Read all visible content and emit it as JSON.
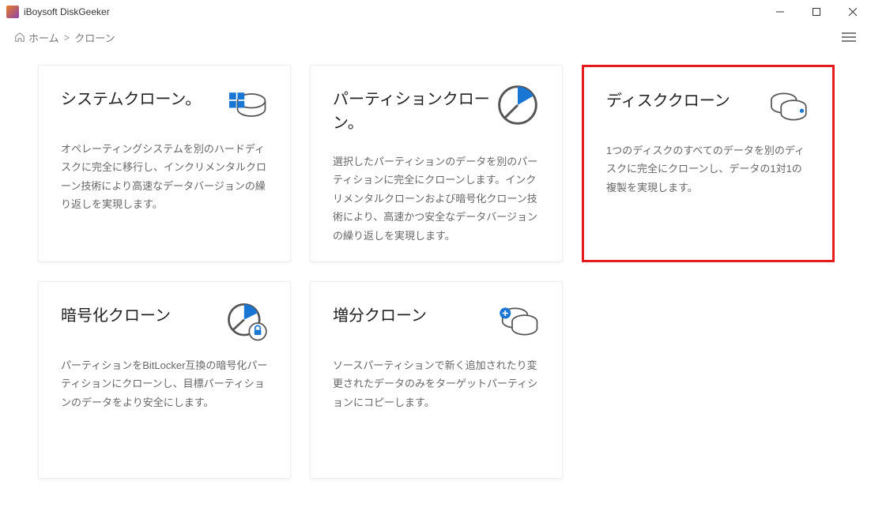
{
  "window": {
    "title": "iBoysoft DiskGeeker"
  },
  "breadcrumb": {
    "home": "ホーム",
    "sep": ">",
    "current": "クローン"
  },
  "cards": [
    {
      "title": "システムクローン。",
      "desc": "オペレーティングシステムを別のハードディスクに完全に移行し、インクリメンタルクローン技術により高速なデータバージョンの繰り返しを実現します。",
      "icon": "system-disk"
    },
    {
      "title": "パーティションクローン。",
      "desc": "選択したパーティションのデータを別のパーティションに完全にクローンします。インクリメンタルクローンおよび暗号化クローン技術により、高速かつ安全なデータバージョンの繰り返しを実現します。",
      "icon": "pie"
    },
    {
      "title": "ディスククローン",
      "desc": "1つのディスクのすべてのデータを別のディスクに完全にクローンし、データの1対1の複製を実現します。",
      "icon": "disks",
      "highlight": true
    },
    {
      "title": "暗号化クローン",
      "desc": "パーティションをBitLocker互換の暗号化パーティションにクローンし、目標パーティションのデータをより安全にします。",
      "icon": "pie-lock"
    },
    {
      "title": "増分クローン",
      "desc": "ソースパーティションで新く追加されたり変更されたデータのみをターゲットパーティションにコピーします。",
      "icon": "disks-plus"
    }
  ]
}
